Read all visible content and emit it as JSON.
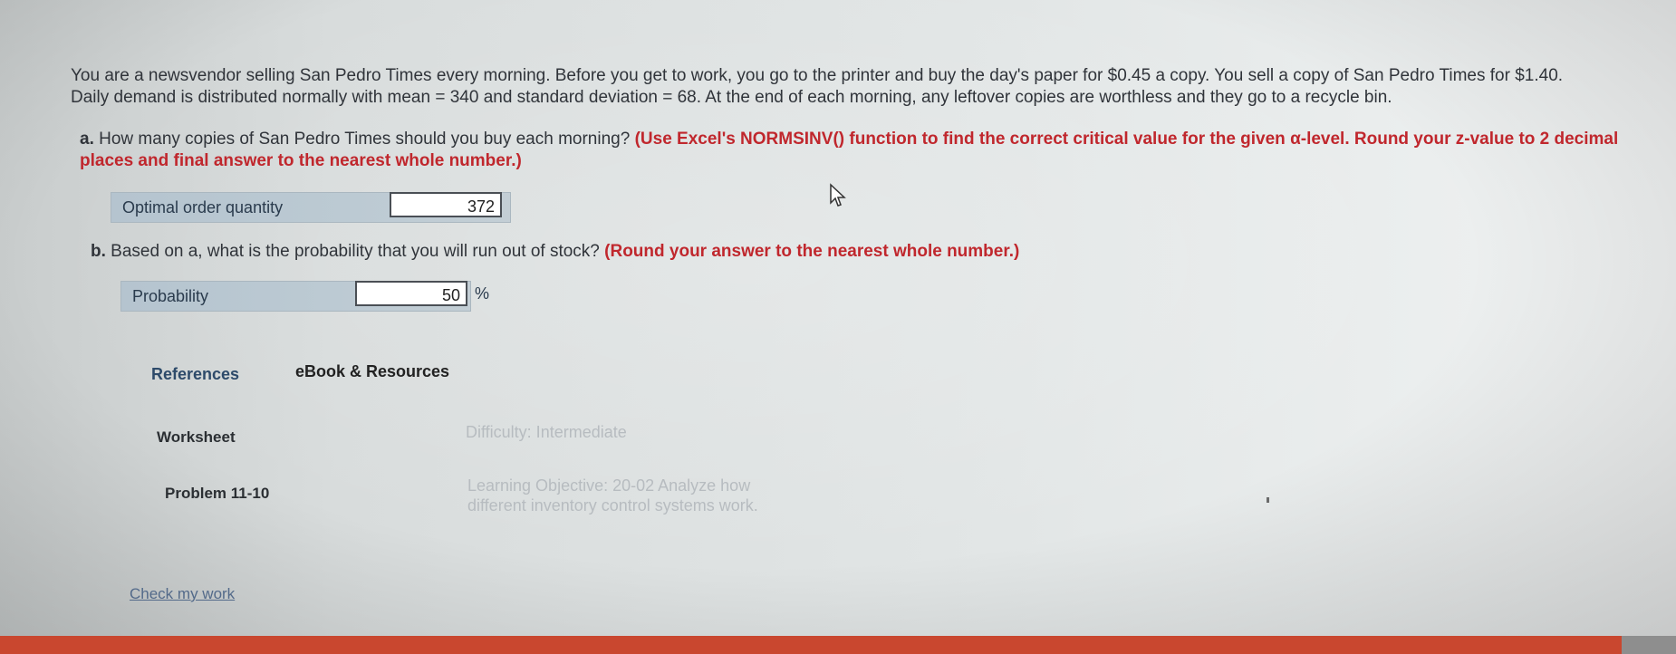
{
  "intro": {
    "line1": "You are a newsvendor selling San Pedro Times every morning. Before you get to work, you go to the printer and buy the day's paper for $0.45 a copy. You sell a copy of San Pedro Times for $1.40.",
    "line2": "Daily demand is distributed normally with mean = 340 and standard deviation = 68. At the end of each morning, any leftover copies are worthless and they go to a recycle bin."
  },
  "question_a": {
    "letter": "a.",
    "text": " How many copies of San Pedro Times should you buy each morning? ",
    "instruction": "(Use Excel's NORMSINV() function to find the correct critical value for the given α-level. Round your z-value to 2 decimal places and final answer to the nearest whole number.)"
  },
  "answer_a": {
    "label": "Optimal order quantity",
    "value": "372"
  },
  "question_b": {
    "letter": "b.",
    "text": " Based on a, what is the probability that you will run out of stock? ",
    "instruction": "(Round your answer to the nearest whole number.)"
  },
  "answer_b": {
    "label": "Probability",
    "value": "50",
    "unit": "%"
  },
  "tabs": {
    "references": "References",
    "ebook": "eBook & Resources"
  },
  "meta": {
    "worksheet": "Worksheet",
    "difficulty": "Difficulty: Intermediate",
    "problem": "Problem 11-10",
    "objective": "Learning Objective: 20-02 Analyze how different inventory control systems work."
  },
  "check_link": "Check my work",
  "colors": {
    "instruction": "#c0272d",
    "answer_row": "#b9c7d0",
    "bottom_bar": "#c9472f"
  }
}
